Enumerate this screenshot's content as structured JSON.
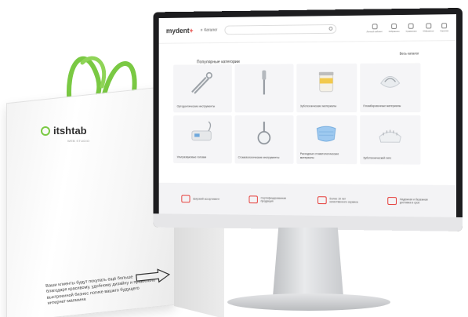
{
  "bag": {
    "brand": "itshtab",
    "tagline": "WEB STUDIO",
    "text": "Ваши клиенты будут покупать ещё больше благодаря красивому, удобному дизайну и правильно выстроенной бизнес логике вашего будущего интернет-магазина",
    "handle_color": "#7ac943"
  },
  "site": {
    "logo": "mydent",
    "logo_plus": "+",
    "catalog_label": "Каталог",
    "search_placeholder": "",
    "header_icons": [
      {
        "icon": "user-icon",
        "label": "Личный кабинет"
      },
      {
        "icon": "heart-icon",
        "label": "Избранное"
      },
      {
        "icon": "compare-icon",
        "label": "Сравнение"
      },
      {
        "icon": "favorite-icon",
        "label": "Избранное"
      },
      {
        "icon": "cart-icon",
        "label": "Корзина"
      }
    ],
    "section_title": "Популярные категории",
    "see_all": "Весь каталог",
    "categories": [
      {
        "label": "Ортодонтические инструменты",
        "icon": "pliers-icon"
      },
      {
        "label": "",
        "icon": "mirror-icon"
      },
      {
        "label": "Зуботехнические материалы",
        "icon": "jar-icon"
      },
      {
        "label": "Пломбировочные материалы",
        "icon": "denture-icon"
      },
      {
        "label": "Ультразвуковые головки",
        "icon": "device-icon"
      },
      {
        "label": "Стоматологические инструменты",
        "icon": "mirror-round-icon"
      },
      {
        "label": "Расходные стоматологические материалы",
        "icon": "mask-icon"
      },
      {
        "label": "Зуботехнический гипс",
        "icon": "model-icon"
      }
    ],
    "features": [
      {
        "icon": "award-icon",
        "label": "Широкий ассортимент"
      },
      {
        "icon": "certificate-icon",
        "label": "Сертифицированная продукция"
      },
      {
        "icon": "stars-icon",
        "label": "Более 10 лет качественного сервиса"
      },
      {
        "icon": "truck-icon",
        "label": "Надежная и бережная доставка в срок"
      }
    ],
    "accent_color": "#e53935"
  }
}
